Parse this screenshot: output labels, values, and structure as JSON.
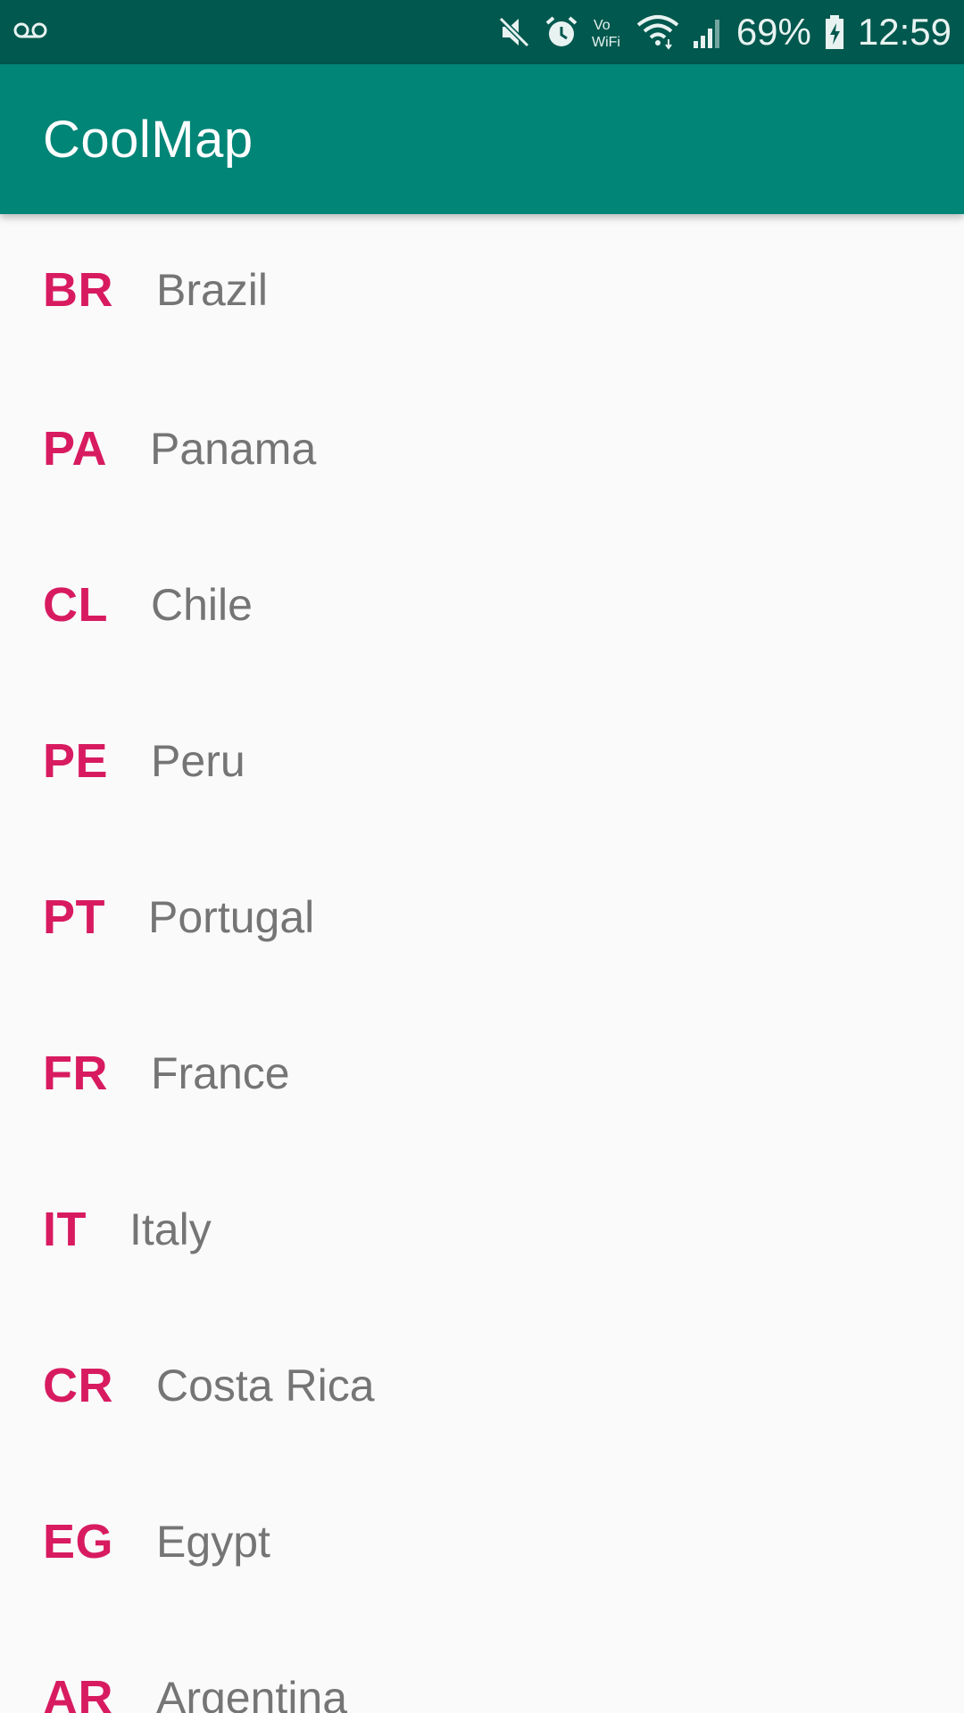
{
  "status_bar": {
    "voicemail_icon": "voicemail-icon",
    "icons": [
      "mute-icon",
      "alarm-icon",
      "vowifi-icon",
      "wifi-icon",
      "signal-icon",
      "battery-charging-icon"
    ],
    "vowifi_label_top": "Vo",
    "vowifi_label_bottom": "WiFi",
    "battery": "69%",
    "time": "12:59"
  },
  "app_bar": {
    "title": "CoolMap",
    "color": "#008577"
  },
  "colors": {
    "status_bar": "#00584e",
    "code_accent": "#d81b60",
    "name_text": "#757575",
    "background": "#fafafa"
  },
  "countries": [
    {
      "code": "BR",
      "name": "Brazil"
    },
    {
      "code": "PA",
      "name": "Panama"
    },
    {
      "code": "CL",
      "name": "Chile"
    },
    {
      "code": "PE",
      "name": "Peru"
    },
    {
      "code": "PT",
      "name": "Portugal"
    },
    {
      "code": "FR",
      "name": "France"
    },
    {
      "code": "IT",
      "name": "Italy"
    },
    {
      "code": "CR",
      "name": "Costa Rica"
    },
    {
      "code": "EG",
      "name": "Egypt"
    },
    {
      "code": "AR",
      "name": "Argentina"
    }
  ]
}
